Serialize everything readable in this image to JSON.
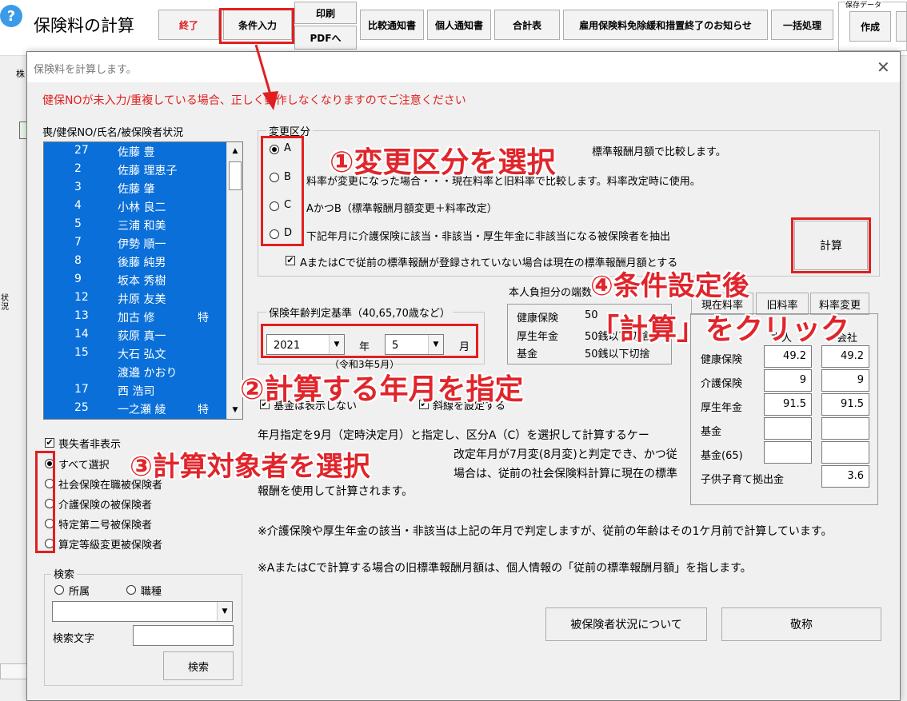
{
  "app": {
    "title": "保険料の計算",
    "help_icon": "?"
  },
  "toolbar": {
    "end": "終了",
    "conditions": "条件入力",
    "print": "印刷",
    "pdf": "PDFへ",
    "compare": "比較通知書",
    "personal": "個人通知書",
    "total": "合計表",
    "notice": "雇用保険料免除緩和措置終了のお知らせ",
    "batch": "一括処理",
    "save_group": "保存データ",
    "create": "作成"
  },
  "background": {
    "side_label1": "株",
    "side_label2": "状況"
  },
  "dialog": {
    "title": "保険料を計算します。",
    "warning": "健保NOが未入力/重複している場合、正しく動作しなくなりますのでご注意ください",
    "list_header": "喪/健保NO/氏名/被保険者状況",
    "list": [
      {
        "no": "27",
        "name": "佐藤 豊",
        "status": ""
      },
      {
        "no": "2",
        "name": "佐藤 理恵子",
        "status": ""
      },
      {
        "no": "3",
        "name": "佐藤 肇",
        "status": ""
      },
      {
        "no": "4",
        "name": "小林 良二",
        "status": ""
      },
      {
        "no": "5",
        "name": "三浦 和美",
        "status": ""
      },
      {
        "no": "7",
        "name": "伊勢 順一",
        "status": ""
      },
      {
        "no": "8",
        "name": "後藤 純男",
        "status": ""
      },
      {
        "no": "9",
        "name": "坂本 秀樹",
        "status": ""
      },
      {
        "no": "12",
        "name": "井原 友美",
        "status": ""
      },
      {
        "no": "13",
        "name": "加古 修",
        "status": "特"
      },
      {
        "no": "14",
        "name": "荻原 真一",
        "status": ""
      },
      {
        "no": "15",
        "name": "大石 弘文",
        "status": ""
      },
      {
        "no": "",
        "name": "渡邉 かおり",
        "status": ""
      },
      {
        "no": "17",
        "name": "西 浩司",
        "status": ""
      },
      {
        "no": "25",
        "name": "一之瀬 綾",
        "status": "特"
      }
    ],
    "hide_lost": "喪失者非表示",
    "select_options": [
      "すべて選択",
      "社会保険在職被保険者",
      "介護保険の被保険者",
      "特定第二号被保険者",
      "算定等級変更被保険者"
    ],
    "search": {
      "title": "検索",
      "opt1": "所属",
      "opt2": "職種",
      "text_label": "検索文字",
      "button": "検索"
    },
    "change_group": {
      "title": "変更区分",
      "options": [
        {
          "letter": "A",
          "text": "標準報酬月額で比較します。"
        },
        {
          "letter": "B",
          "text": "料率が変更になった場合・・・現在料率と旧料率で比較します。料率改定時に使用。"
        },
        {
          "letter": "C",
          "text": "AかつB（標準報酬月額変更＋料率改定）"
        },
        {
          "letter": "D",
          "text": "下記年月に介護保険に該当・非該当・厚生年金に非該当になる被保険者を抽出"
        }
      ],
      "checkbox": "AまたはCで従前の標準報酬が登録されていない場合は現在の標準報酬月額とする"
    },
    "calc_button": "計算",
    "age_group": {
      "title": "保険年齢判定基準（40,65,70歳など）",
      "year": "2021",
      "year_unit": "年",
      "month": "5",
      "month_unit": "月",
      "era": "（令和3年5月）"
    },
    "burden": {
      "title": "本人負担分の端数",
      "rows": [
        {
          "label": "健康保険",
          "value": "50"
        },
        {
          "label": "厚生年金",
          "value": "50銭以下切捨"
        },
        {
          "label": "基金",
          "value": "50銭以下切捨"
        }
      ]
    },
    "opt_checks": [
      "基金は表示しない",
      "斜線を設定する"
    ],
    "note1_lines": [
      "年月指定を9月（定時決定月）と指定し、区分A（C）を選択して計算するケー",
      "改定年月が7月変(8月変)と判定でき、かつ従",
      "場合は、従前の社会保険料計算に現在の標準",
      "報酬を使用して計算されます。"
    ],
    "note2": "※介護保険や厚生年金の該当・非該当は上記の年月で判定しますが、従前の年齢はその1ケ月前で計算しています。",
    "note3": "※AまたはCで計算する場合の旧標準報酬月額は、個人情報の「従前の標準報酬月額」を指します。",
    "rate_tabs": [
      "現在料率",
      "旧料率",
      "料率変更"
    ],
    "rate_header": [
      "本人",
      "会社"
    ],
    "rates": [
      {
        "label": "健康保険",
        "self": "49.2",
        "company": "49.2"
      },
      {
        "label": "介護保険",
        "self": "9",
        "company": "9"
      },
      {
        "label": "厚生年金",
        "self": "91.5",
        "company": "91.5"
      },
      {
        "label": "基金",
        "self": "",
        "company": ""
      },
      {
        "label": "基金(65)",
        "self": "",
        "company": ""
      },
      {
        "label": "子供子育て拠出金",
        "self": "",
        "company": "3.6"
      }
    ],
    "btn_status": "被保険者状況について",
    "btn_honorific": "敬称"
  },
  "annotations": {
    "a1": "①変更区分を選択",
    "a2": "②計算する年月を指定",
    "a3": "③計算対象者を選択",
    "a4_line1": "④条件設定後",
    "a4_line2": "「計算」をクリック"
  },
  "colors": {
    "list_selection": "#0a6fd8",
    "annotation": "#e0252b",
    "help_icon": "#3b9be8"
  }
}
